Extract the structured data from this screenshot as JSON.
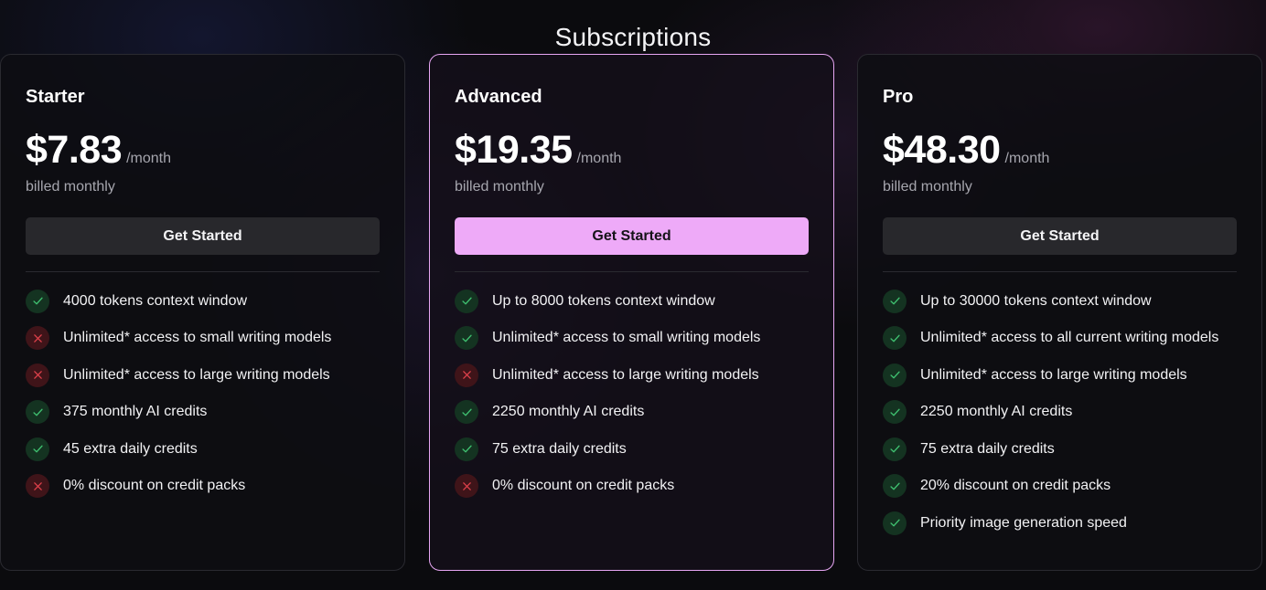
{
  "page": {
    "title": "Subscriptions"
  },
  "colors": {
    "background": "#0b0b0e",
    "accent": "#eeaaf8",
    "featured_border": "#e7a6f3",
    "check": "#3fbf6f",
    "cross": "#e0414b"
  },
  "plans": [
    {
      "name": "Starter",
      "price": "$7.83",
      "period": "/month",
      "billing": "billed monthly",
      "cta": "Get Started",
      "featured": false,
      "features": [
        {
          "text": "4000 tokens context window",
          "included": true,
          "icon": "check-icon"
        },
        {
          "text": "Unlimited* access to small writing models",
          "included": false,
          "icon": "close-icon"
        },
        {
          "text": "Unlimited* access to large writing models",
          "included": false,
          "icon": "close-icon"
        },
        {
          "text": "375 monthly AI credits",
          "included": true,
          "icon": "check-icon"
        },
        {
          "text": "45 extra daily credits",
          "included": true,
          "icon": "check-icon"
        },
        {
          "text": "0% discount on credit packs",
          "included": false,
          "icon": "close-icon"
        }
      ]
    },
    {
      "name": "Advanced",
      "price": "$19.35",
      "period": "/month",
      "billing": "billed monthly",
      "cta": "Get Started",
      "featured": true,
      "features": [
        {
          "text": "Up to 8000 tokens context window",
          "included": true,
          "icon": "check-icon"
        },
        {
          "text": "Unlimited* access to small writing models",
          "included": true,
          "icon": "check-icon"
        },
        {
          "text": "Unlimited* access to large writing models",
          "included": false,
          "icon": "close-icon"
        },
        {
          "text": "2250 monthly AI credits",
          "included": true,
          "icon": "check-icon"
        },
        {
          "text": "75 extra daily credits",
          "included": true,
          "icon": "check-icon"
        },
        {
          "text": "0% discount on credit packs",
          "included": false,
          "icon": "close-icon"
        }
      ]
    },
    {
      "name": "Pro",
      "price": "$48.30",
      "period": "/month",
      "billing": "billed monthly",
      "cta": "Get Started",
      "featured": false,
      "features": [
        {
          "text": "Up to 30000 tokens context window",
          "included": true,
          "icon": "check-icon"
        },
        {
          "text": "Unlimited* access to all current writing models",
          "included": true,
          "icon": "check-icon"
        },
        {
          "text": "Unlimited* access to large writing models",
          "included": true,
          "icon": "check-icon"
        },
        {
          "text": "2250 monthly AI credits",
          "included": true,
          "icon": "check-icon"
        },
        {
          "text": "75 extra daily credits",
          "included": true,
          "icon": "check-icon"
        },
        {
          "text": "20% discount on credit packs",
          "included": true,
          "icon": "check-icon"
        },
        {
          "text": "Priority image generation speed",
          "included": true,
          "icon": "check-icon"
        }
      ]
    }
  ]
}
